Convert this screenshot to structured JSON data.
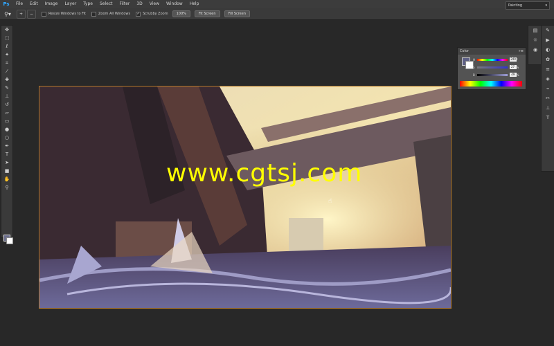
{
  "menubar": {
    "logo": "Ps",
    "items": [
      "File",
      "Edit",
      "Image",
      "Layer",
      "Type",
      "Select",
      "Filter",
      "3D",
      "View",
      "Window",
      "Help"
    ]
  },
  "options": {
    "resize_windows": "Resize Windows to Fit",
    "zoom_all": "Zoom All Windows",
    "scrubby_zoom": "Scrubby Zoom",
    "btn_100": "100%",
    "btn_fit": "Fit Screen",
    "btn_fill": "Fill Screen",
    "workspace": "Painting"
  },
  "color_panel": {
    "title": "Color",
    "h_label": "H",
    "h_value": "240",
    "s_label": "S",
    "s_value": "27",
    "b_label": "B",
    "b_value": "49",
    "h_unit": "°",
    "s_unit": "%",
    "b_unit": "%",
    "fg_color": "#5e6085"
  },
  "watermark": "www.cgtsj.com",
  "icons": {
    "zoom": "zoom-icon"
  }
}
